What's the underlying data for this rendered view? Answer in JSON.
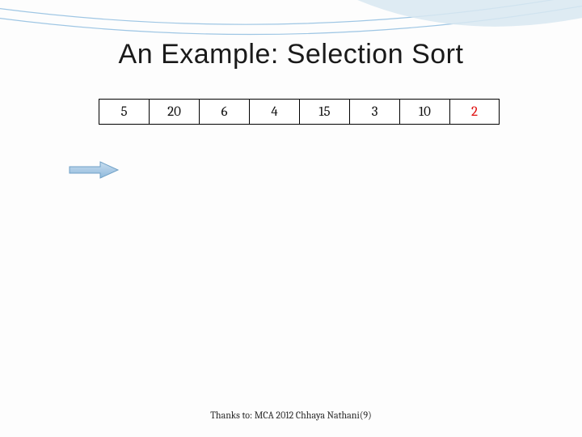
{
  "title": "An Example: Selection Sort",
  "array": {
    "cells": [
      {
        "value": "5",
        "highlight": false
      },
      {
        "value": "20",
        "highlight": false
      },
      {
        "value": "6",
        "highlight": false
      },
      {
        "value": "4",
        "highlight": false
      },
      {
        "value": "15",
        "highlight": false
      },
      {
        "value": "3",
        "highlight": false
      },
      {
        "value": "10",
        "highlight": false
      },
      {
        "value": "2",
        "highlight": true
      }
    ]
  },
  "arrow_color": "#9ec6e4",
  "credit": "Thanks to: MCA 2012 Chhaya Nathani(9)",
  "decoration": {
    "line_color": "#9ec6e4",
    "swoosh_color": "#d8e7f1"
  }
}
